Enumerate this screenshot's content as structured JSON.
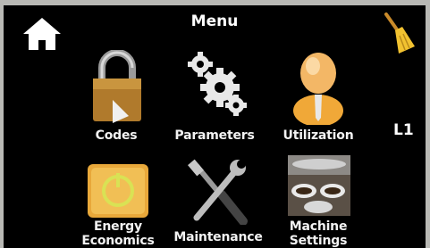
{
  "header": {
    "title": "Menu",
    "home_icon": "home-icon",
    "clean_icon": "broom-icon"
  },
  "level_indicator": "L1",
  "menu": {
    "codes": {
      "label": "Codes",
      "icon": "padlock-icon"
    },
    "parameters": {
      "label": "Parameters",
      "icon": "gears-icon"
    },
    "utilization": {
      "label": "Utilization",
      "icon": "user-icon"
    },
    "energy": {
      "label_line1": "Energy",
      "label_line2": "Economics",
      "icon": "power-icon"
    },
    "maintenance": {
      "label": "Maintenance",
      "icon": "tools-icon"
    },
    "machine": {
      "label_line1": "Machine",
      "label_line2": "Settings",
      "icon": "coffee-cups-icon"
    }
  }
}
